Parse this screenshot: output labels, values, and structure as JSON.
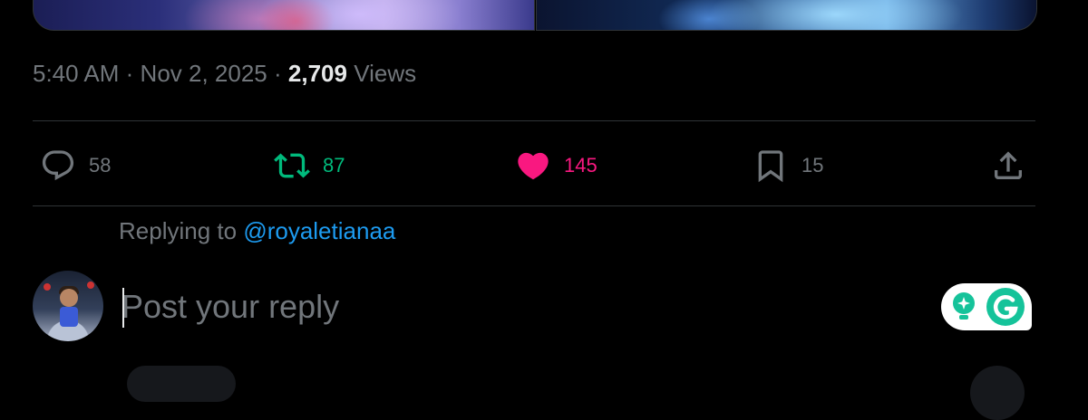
{
  "tweet": {
    "time": "5:40 AM",
    "date": "Nov 2, 2025",
    "separator": "·",
    "views_count": "2,709",
    "views_label": "Views"
  },
  "actions": {
    "reply": {
      "icon": "reply-icon",
      "count": "58"
    },
    "retweet": {
      "icon": "retweet-icon",
      "count": "87",
      "color": "#00ba7c"
    },
    "like": {
      "icon": "heart-icon",
      "count": "145",
      "color": "#f91880"
    },
    "bookmark": {
      "icon": "bookmark-icon",
      "count": "15"
    },
    "share": {
      "icon": "share-icon"
    }
  },
  "reply_box": {
    "replying_to_label": "Replying to",
    "handle": "@royaletianaa",
    "placeholder": "Post your reply",
    "handle_color": "#1d9bf0"
  },
  "extension": {
    "name": "Grammarly",
    "icons": [
      "lightbulb-sparkle-icon",
      "grammarly-g-icon"
    ],
    "accent": "#15c39a"
  }
}
